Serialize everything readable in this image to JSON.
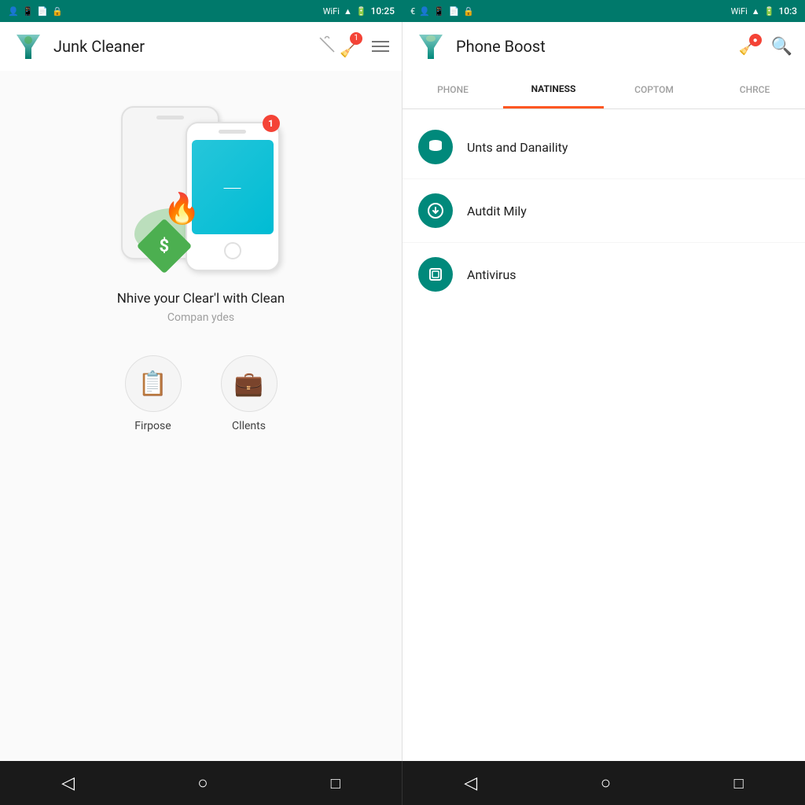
{
  "left_panel": {
    "status_bar": {
      "time": "10:25",
      "icons": [
        "person-icon",
        "phone-icon",
        "file-icon",
        "lock-icon"
      ]
    },
    "app_bar": {
      "title": "Junk Cleaner",
      "notification_count": "1",
      "menu_icon": "hamburger-menu"
    },
    "content": {
      "main_text": "Nhive your Clear'l with Clean",
      "sub_text": "Compan ydes",
      "action_items": [
        {
          "label": "Firpose",
          "icon": "clipboard-icon"
        },
        {
          "label": "Cllents",
          "icon": "briefcase-icon"
        }
      ]
    },
    "nav_bar": {
      "buttons": [
        "back-button",
        "home-button",
        "square-button"
      ]
    }
  },
  "right_panel": {
    "status_bar": {
      "time": "10:3",
      "icons": [
        "euro-icon",
        "person-icon",
        "phone-icon",
        "file-icon",
        "lock-icon"
      ]
    },
    "app_bar": {
      "title": "Phone Boost",
      "search_icon": "search-icon",
      "notification_icon": "notification-icon"
    },
    "tabs": [
      {
        "label": "PHONE",
        "active": false
      },
      {
        "label": "NATINESS",
        "active": true
      },
      {
        "label": "COPTOM",
        "active": false
      },
      {
        "label": "CHRCE",
        "active": false
      }
    ],
    "list_items": [
      {
        "text": "Unts and Danaility",
        "icon": "database-icon"
      },
      {
        "text": "Autdit Mily",
        "icon": "download-icon"
      },
      {
        "text": "Antivirus",
        "icon": "shield-icon"
      }
    ],
    "nav_bar": {
      "buttons": [
        "back-button",
        "home-button",
        "square-button"
      ]
    }
  },
  "colors": {
    "teal_dark": "#00796B",
    "teal_medium": "#00897B",
    "orange": "#FF7043",
    "orange_red": "#FF5722",
    "green": "#4CAF50",
    "red": "#F44336",
    "nav_bg": "#212121"
  }
}
